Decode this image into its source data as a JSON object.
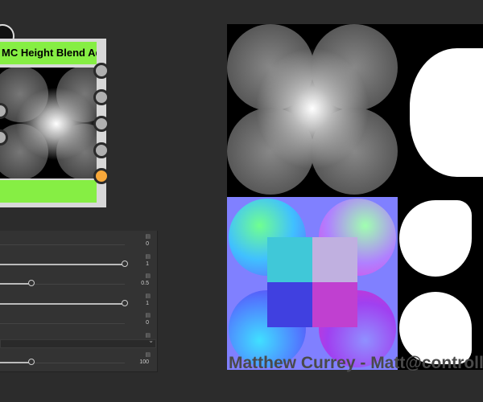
{
  "node": {
    "title": "MC Height Blend Ad...",
    "output_pins": [
      "output-1",
      "output-2",
      "output-3",
      "output-4",
      "output-5"
    ],
    "colors": {
      "header": "#86ee44",
      "pin": "#b0b0b0",
      "active_pin": "#f8a83a"
    }
  },
  "params": [
    {
      "value": "0",
      "fraction": 0,
      "type": "slider"
    },
    {
      "value": "1",
      "fraction": 1,
      "type": "slider"
    },
    {
      "value": "0.5",
      "fraction": 0.25,
      "type": "slider"
    },
    {
      "value": "1",
      "fraction": 1,
      "type": "slider"
    },
    {
      "value": "0",
      "fraction": 0,
      "type": "slider"
    },
    {
      "value": "",
      "type": "dropdown"
    },
    {
      "value": "100",
      "fraction": 0.25,
      "type": "slider"
    }
  ],
  "preview": {
    "credit": "Matthew Currey - Matt@controlle"
  }
}
